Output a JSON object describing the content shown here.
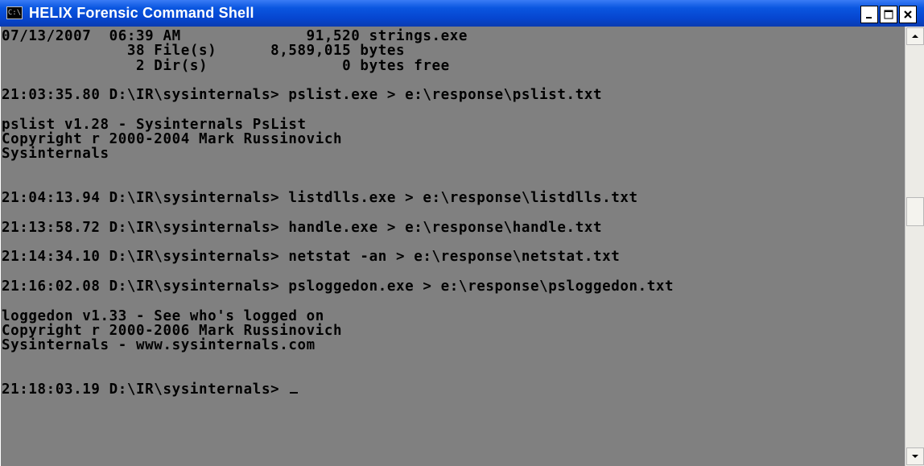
{
  "window": {
    "title": "HELIX Forensic Command Shell",
    "icon_text": "C:\\",
    "icon": "console-icon"
  },
  "title_buttons": {
    "minimize": "minimize-icon",
    "maximize": "maximize-icon",
    "close": "close-icon"
  },
  "console": {
    "lines": [
      "07/13/2007  06:39 AM              91,520 strings.exe",
      "              38 File(s)      8,589,015 bytes",
      "               2 Dir(s)               0 bytes free",
      "",
      "21:03:35.80 D:\\IR\\sysinternals> pslist.exe > e:\\response\\pslist.txt",
      "",
      "pslist v1.28 - Sysinternals PsList",
      "Copyright r 2000-2004 Mark Russinovich",
      "Sysinternals",
      "",
      "",
      "21:04:13.94 D:\\IR\\sysinternals> listdlls.exe > e:\\response\\listdlls.txt",
      "",
      "21:13:58.72 D:\\IR\\sysinternals> handle.exe > e:\\response\\handle.txt",
      "",
      "21:14:34.10 D:\\IR\\sysinternals> netstat -an > e:\\response\\netstat.txt",
      "",
      "21:16:02.08 D:\\IR\\sysinternals> psloggedon.exe > e:\\response\\psloggedon.txt",
      "",
      "loggedon v1.33 - See who's logged on",
      "Copyright r 2000-2006 Mark Russinovich",
      "Sysinternals - www.sysinternals.com",
      "",
      "",
      "21:18:03.19 D:\\IR\\sysinternals> "
    ]
  },
  "colors": {
    "console_bg": "#808080",
    "console_text": "#000000",
    "titlebar": "#0a56e0"
  }
}
